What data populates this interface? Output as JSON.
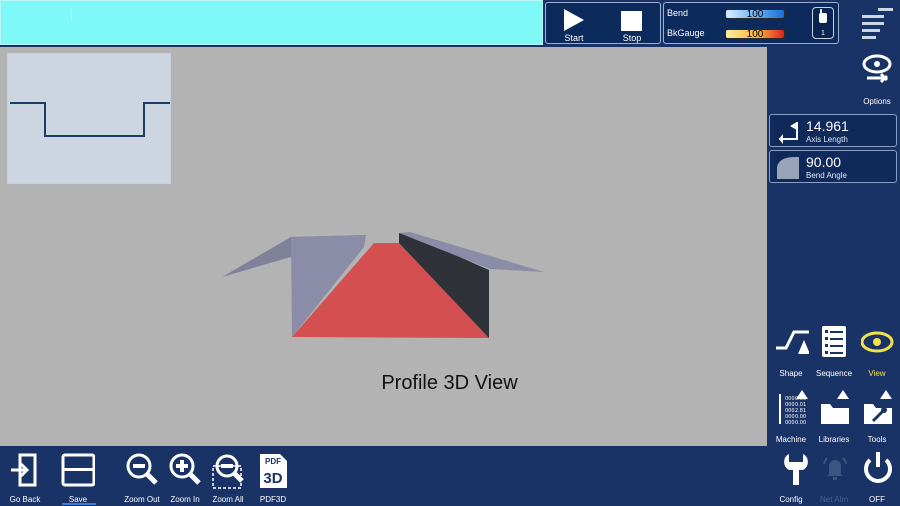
{
  "run_controls": {
    "start_label": "Start",
    "stop_label": "Stop"
  },
  "gauges": [
    {
      "label": "Bend",
      "value": "100",
      "colors": [
        "#cfe8ff",
        "#2a7fe0"
      ]
    },
    {
      "label": "BkGauge",
      "value": "100",
      "colors": [
        "#ffe28a",
        "#e02020"
      ]
    }
  ],
  "hand_counter": "1",
  "view": {
    "title": "Profile 3D View"
  },
  "params": {
    "axis_length": {
      "value": "14.961",
      "label": "Axis Length"
    },
    "bend_angle": {
      "value": "90.00",
      "label": "Bend Angle"
    }
  },
  "side_buttons": {
    "options": "Options",
    "shape": "Shape",
    "sequence": "Sequence",
    "view": "View",
    "machine": "Machine",
    "libraries": "Libraries",
    "tools": "Tools",
    "config": "Config",
    "net_alm": "Net Alm",
    "off": "OFF"
  },
  "toolbar": {
    "go_back": "Go Back",
    "save": "Save",
    "zoom_out": "Zoom Out",
    "zoom_in": "Zoom In",
    "zoom_all": "Zoom All",
    "pdf3d": "PDF3D"
  },
  "icons": {
    "pdf_top": "PDF",
    "pdf_main": "3D",
    "machine_numbers": [
      "000",
      "0.00",
      "000",
      "0.01",
      "000",
      "2.81",
      "000",
      "0.00",
      "000",
      "0.00"
    ]
  },
  "colors": {
    "status_bar": "#7ff8f8",
    "panel": "#1a3366",
    "viewport": "#b3b3b3",
    "view_accent": "#f2e24a",
    "part_floor": "#d45050",
    "part_flange": "#8a8ca8"
  }
}
